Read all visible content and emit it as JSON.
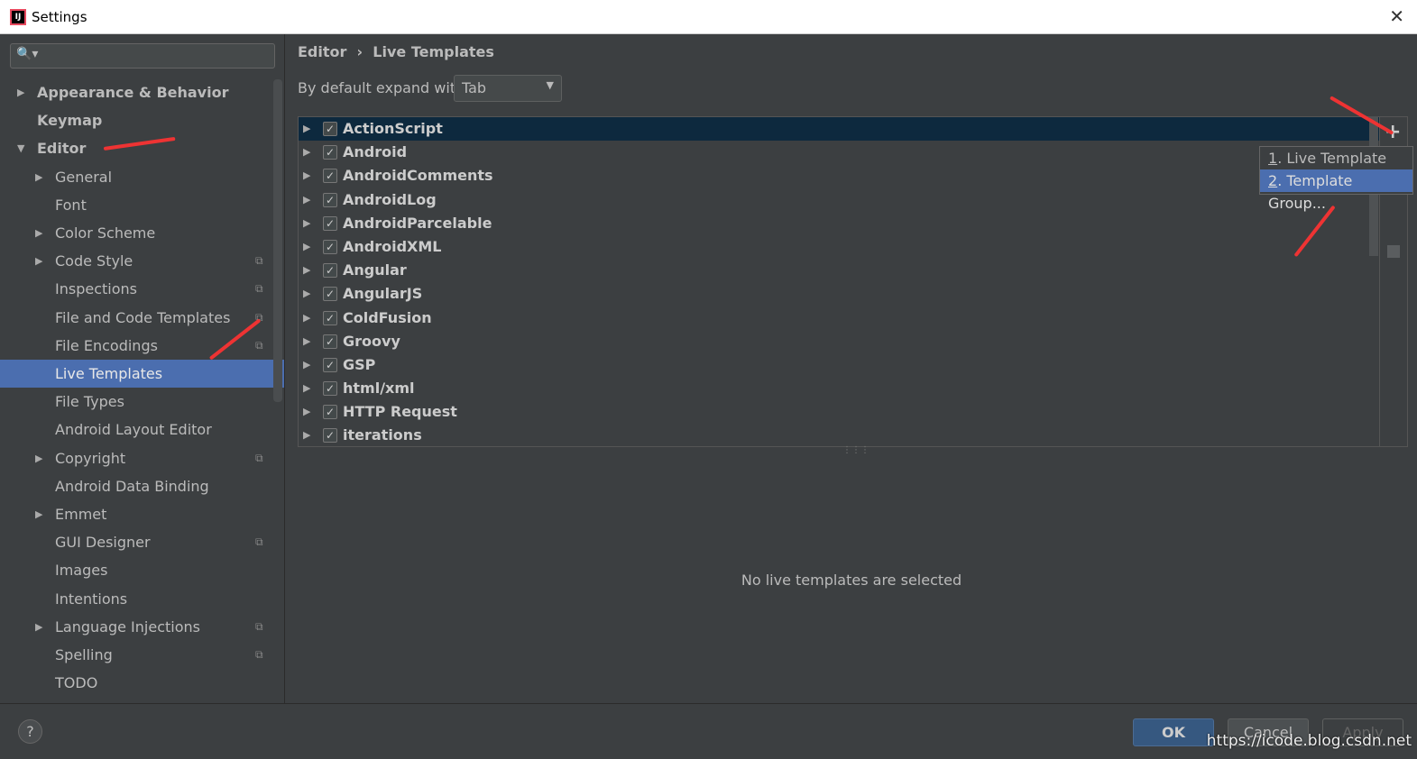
{
  "window": {
    "title": "Settings",
    "close": "✕"
  },
  "search": {
    "placeholder": "",
    "icon": "🔍▾"
  },
  "sidebar": {
    "items": [
      {
        "label": "Appearance & Behavior",
        "level": 0,
        "arrow": "▶",
        "bold": true
      },
      {
        "label": "Keymap",
        "level": 0,
        "arrow": "",
        "bold": true
      },
      {
        "label": "Editor",
        "level": 0,
        "arrow": "▼",
        "bold": true
      },
      {
        "label": "General",
        "level": 1,
        "arrow": "▶"
      },
      {
        "label": "Font",
        "level": 1,
        "arrow": ""
      },
      {
        "label": "Color Scheme",
        "level": 1,
        "arrow": "▶"
      },
      {
        "label": "Code Style",
        "level": 1,
        "arrow": "▶",
        "copy": true
      },
      {
        "label": "Inspections",
        "level": 1,
        "arrow": "",
        "copy": true
      },
      {
        "label": "File and Code Templates",
        "level": 1,
        "arrow": "",
        "copy": true
      },
      {
        "label": "File Encodings",
        "level": 1,
        "arrow": "",
        "copy": true
      },
      {
        "label": "Live Templates",
        "level": 1,
        "arrow": "",
        "selected": true
      },
      {
        "label": "File Types",
        "level": 1,
        "arrow": ""
      },
      {
        "label": "Android Layout Editor",
        "level": 1,
        "arrow": ""
      },
      {
        "label": "Copyright",
        "level": 1,
        "arrow": "▶",
        "copy": true
      },
      {
        "label": "Android Data Binding",
        "level": 1,
        "arrow": ""
      },
      {
        "label": "Emmet",
        "level": 1,
        "arrow": "▶"
      },
      {
        "label": "GUI Designer",
        "level": 1,
        "arrow": "",
        "copy": true
      },
      {
        "label": "Images",
        "level": 1,
        "arrow": ""
      },
      {
        "label": "Intentions",
        "level": 1,
        "arrow": ""
      },
      {
        "label": "Language Injections",
        "level": 1,
        "arrow": "▶",
        "copy": true
      },
      {
        "label": "Spelling",
        "level": 1,
        "arrow": "",
        "copy": true
      },
      {
        "label": "TODO",
        "level": 1,
        "arrow": ""
      }
    ]
  },
  "breadcrumb": {
    "parent": "Editor",
    "sep": "›",
    "current": "Live Templates"
  },
  "expand": {
    "label": "By default expand with",
    "value": "Tab"
  },
  "templates": [
    "ActionScript",
    "Android",
    "AndroidComments",
    "AndroidLog",
    "AndroidParcelable",
    "AndroidXML",
    "Angular",
    "AngularJS",
    "ColdFusion",
    "Groovy",
    "GSP",
    "html/xml",
    "HTTP Request",
    "iterations"
  ],
  "popup": {
    "items": [
      {
        "num": "1",
        "label": ". Live Template"
      },
      {
        "num": "2",
        "label": ". Template Group..."
      }
    ]
  },
  "empty_text": "No live templates are selected",
  "buttons": {
    "help": "?",
    "ok": "OK",
    "cancel": "Cancel",
    "apply": "Apply"
  },
  "watermark": "https://icode.blog.csdn.net",
  "colors": {
    "selection": "#4b6eaf",
    "annotation_arrow": "#ee3333"
  }
}
